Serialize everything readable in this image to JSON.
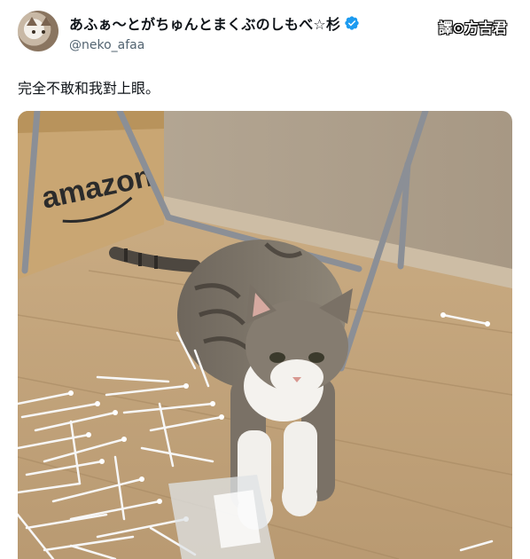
{
  "tweet": {
    "author": {
      "display_name": "あふぁ〜とがちゅんとまくぶのしもべ☆杉",
      "handle": "@neko_afaa",
      "verified": true,
      "verified_color": "#1d9bf0"
    },
    "text": "完全不敢和我對上眼。",
    "translator_watermark": "譯⊙方吉君",
    "photo": {
      "box_text": "amazon"
    }
  }
}
